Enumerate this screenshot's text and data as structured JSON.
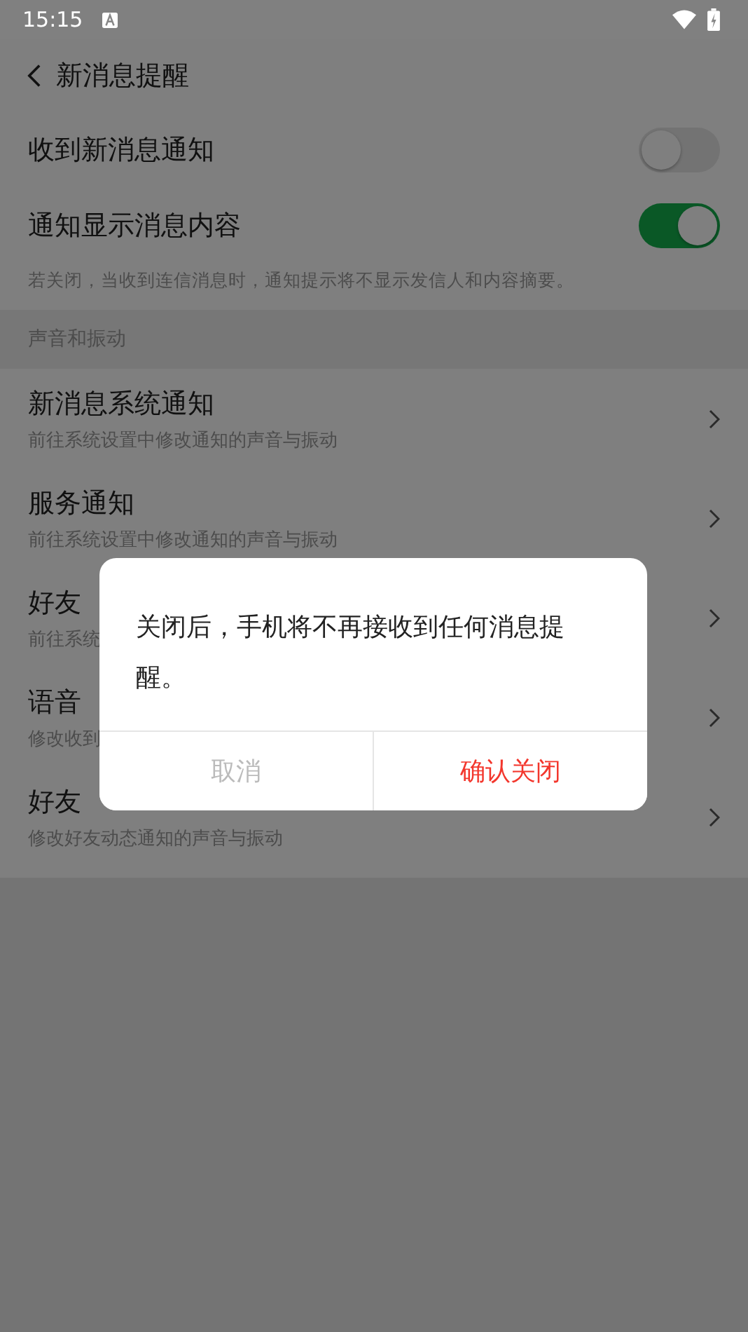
{
  "status_bar": {
    "time": "15:15"
  },
  "header": {
    "title": "新消息提醒"
  },
  "toggles": [
    {
      "label": "收到新消息通知",
      "on": false
    },
    {
      "label": "通知显示消息内容",
      "on": true
    }
  ],
  "toggles_note": "若关闭，当收到连信消息时，通知提示将不显示发信人和内容摘要。",
  "section": {
    "label": "声音和振动"
  },
  "items": [
    {
      "title": "新消息系统通知",
      "subtitle": "前往系统设置中修改通知的声音与振动"
    },
    {
      "title": "服务通知",
      "subtitle": "前往系统设置中修改通知的声音与振动"
    },
    {
      "title": "好友",
      "subtitle": "前往系统"
    },
    {
      "title": "语音",
      "subtitle": "修改收到"
    },
    {
      "title": "好友",
      "subtitle": "修改好友动态通知的声音与振动"
    }
  ],
  "dialog": {
    "message": "关闭后，手机将不再接收到任何消息提醒。",
    "buttons": [
      {
        "label": "取消",
        "kind": "cancel"
      },
      {
        "label": "确认关闭",
        "kind": "confirm"
      }
    ]
  }
}
